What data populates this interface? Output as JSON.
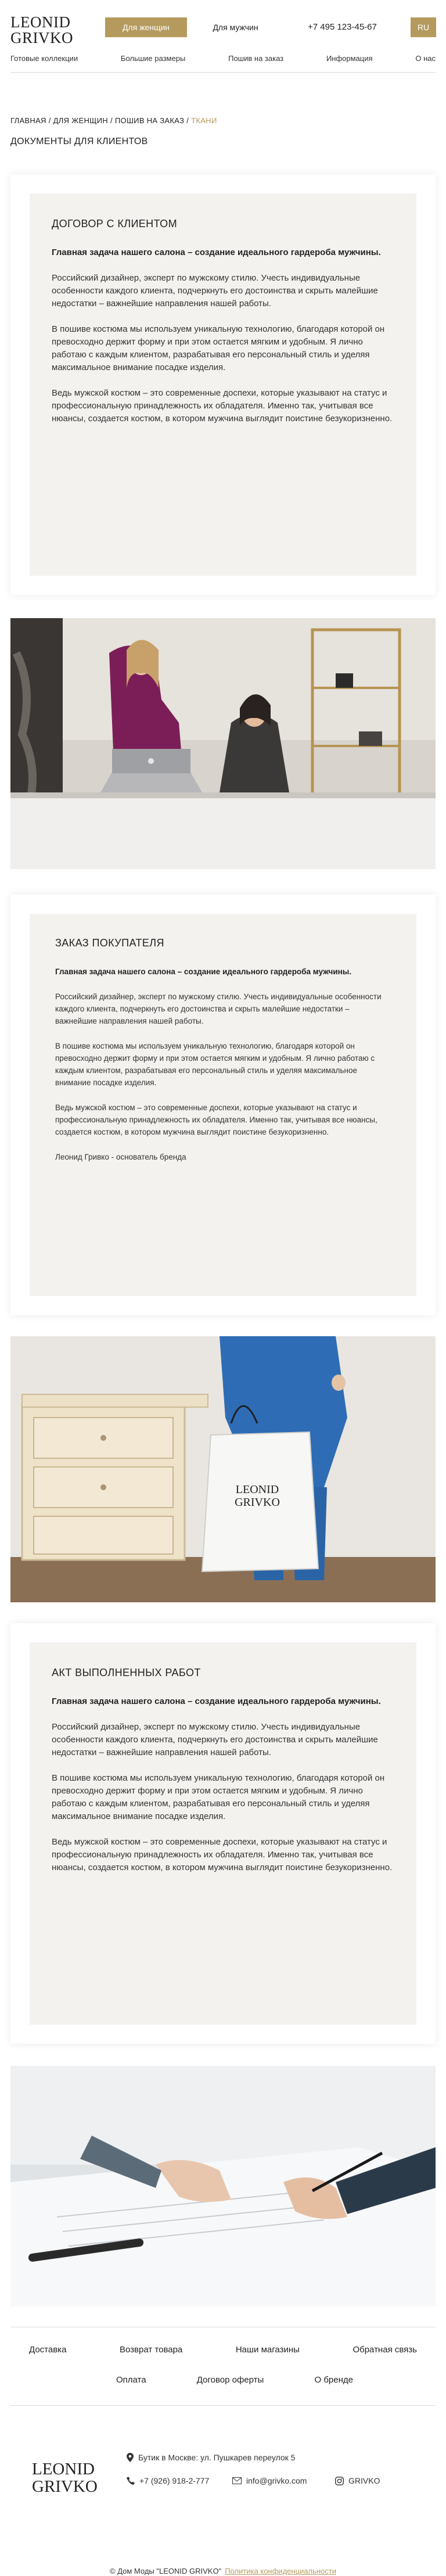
{
  "header": {
    "logo_line1": "LEONID",
    "logo_line2": "GRIVKO",
    "women_button": "Для женщин",
    "men_button": "Для мужчин",
    "phone": "+7 495 123-45-67",
    "lang": "RU",
    "nav": [
      "Готовые коллекции",
      "Большие размеры",
      "Пошив на заказ",
      "Информация",
      "О нас"
    ]
  },
  "breadcrumb": {
    "items": [
      "ГЛАВНАЯ",
      "ДЛЯ ЖЕНЩИН",
      "ПОШИВ НА ЗАКАЗ"
    ],
    "current": "ТКАНИ",
    "separator": "/"
  },
  "page_title": "ДОКУМЕНТЫ ДЛЯ КЛИЕНТОВ",
  "cards": [
    {
      "title": "ДОГОВОР С КЛИЕНТОМ",
      "lead": "Главная задача нашего салона – создание идеального гардероба мужчины.",
      "paragraphs": [
        "Российский дизайнер, эксперт по мужскому стилю. Учесть индивидуальные особенности каждого клиента, подчеркнуть его достоинства и скрыть малейшие недостатки – важнейшие направления нашей работы.",
        "В пошиве костюма мы используем уникальную технологию, благодаря которой он превосходно держит форму и при этом остается мягким и удобным. Я лично работаю с каждым клиентом, разрабатывая его персональный стиль и уделяя максимальное внимание посадке изделия.",
        "Ведь мужской костюм – это современные доспехи, которые указывают на статус и профессиональную принадлежность их обладателя. Именно так, учитывая все нюансы, создается костюм, в котором мужчина выглядит поистине безукоризненно."
      ]
    },
    {
      "title": "ЗАКАЗ ПОКУПАТЕЛЯ",
      "lead": "Главная задача нашего салона – создание идеального гардероба мужчины.",
      "paragraphs": [
        "Российский дизайнер, эксперт по мужскому стилю. Учесть индивидуальные особенности каждого клиента, подчеркнуть его достоинства и скрыть малейшие недостатки – важнейшие направления нашей работы.",
        "В пошиве костюма мы используем уникальную технологию, благодаря которой он превосходно держит форму и при этом остается мягким и удобным. Я лично работаю с каждым клиентом, разрабатывая его персональный стиль и уделяя максимальное внимание посадке изделия.",
        "Ведь мужской костюм – это современные доспехи, которые указывают на статус и профессиональную принадлежность их обладателя. Именно так, учитывая все нюансы, создается костюм, в котором мужчина выглядит поистине безукоризненно.",
        "Леонид Гривко - основатель бренда"
      ]
    },
    {
      "title": "АКТ ВЫПОЛНЕННЫХ РАБОТ",
      "lead": "Главная задача нашего салона – создание идеального гардероба мужчины.",
      "paragraphs": [
        "Российский дизайнер, эксперт по мужскому стилю. Учесть индивидуальные особенности каждого клиента, подчеркнуть его достоинства и скрыть малейшие недостатки – важнейшие направления нашей работы.",
        "В пошиве костюма мы используем уникальную технологию, благодаря которой он превосходно держит форму и при этом остается мягким и удобным. Я лично работаю с каждым клиентом, разрабатывая его персональный стиль и уделяя максимальное внимание посадке изделия.",
        "Ведь мужской костюм – это современные доспехи, которые указывают на статус и профессиональную принадлежность их обладателя. Именно так, учитывая все нюансы, создается костюм, в котором мужчина выглядит поистине безукоризненно."
      ]
    }
  ],
  "bag_logo_line1": "LEONID",
  "bag_logo_line2": "GRIVKO",
  "footer": {
    "nav_row1": [
      "Доставка",
      "Возврат товара",
      "Наши магазины",
      "Обратная связь"
    ],
    "nav_row2": [
      "Оплата",
      "Договор оферты",
      "О бренде"
    ],
    "logo_line1": "LEONID",
    "logo_line2": "GRIVKO",
    "address": "Бутик в Москве: ул. Пушкарев переулок 5",
    "phone": "+7 (926) 918-2-777",
    "email": "info@grivko.com",
    "social": "GRIVKO",
    "copyright": "© Дом Моды \"LEONID GRIVKO\"",
    "privacy": "Политика конфиденциальности"
  }
}
